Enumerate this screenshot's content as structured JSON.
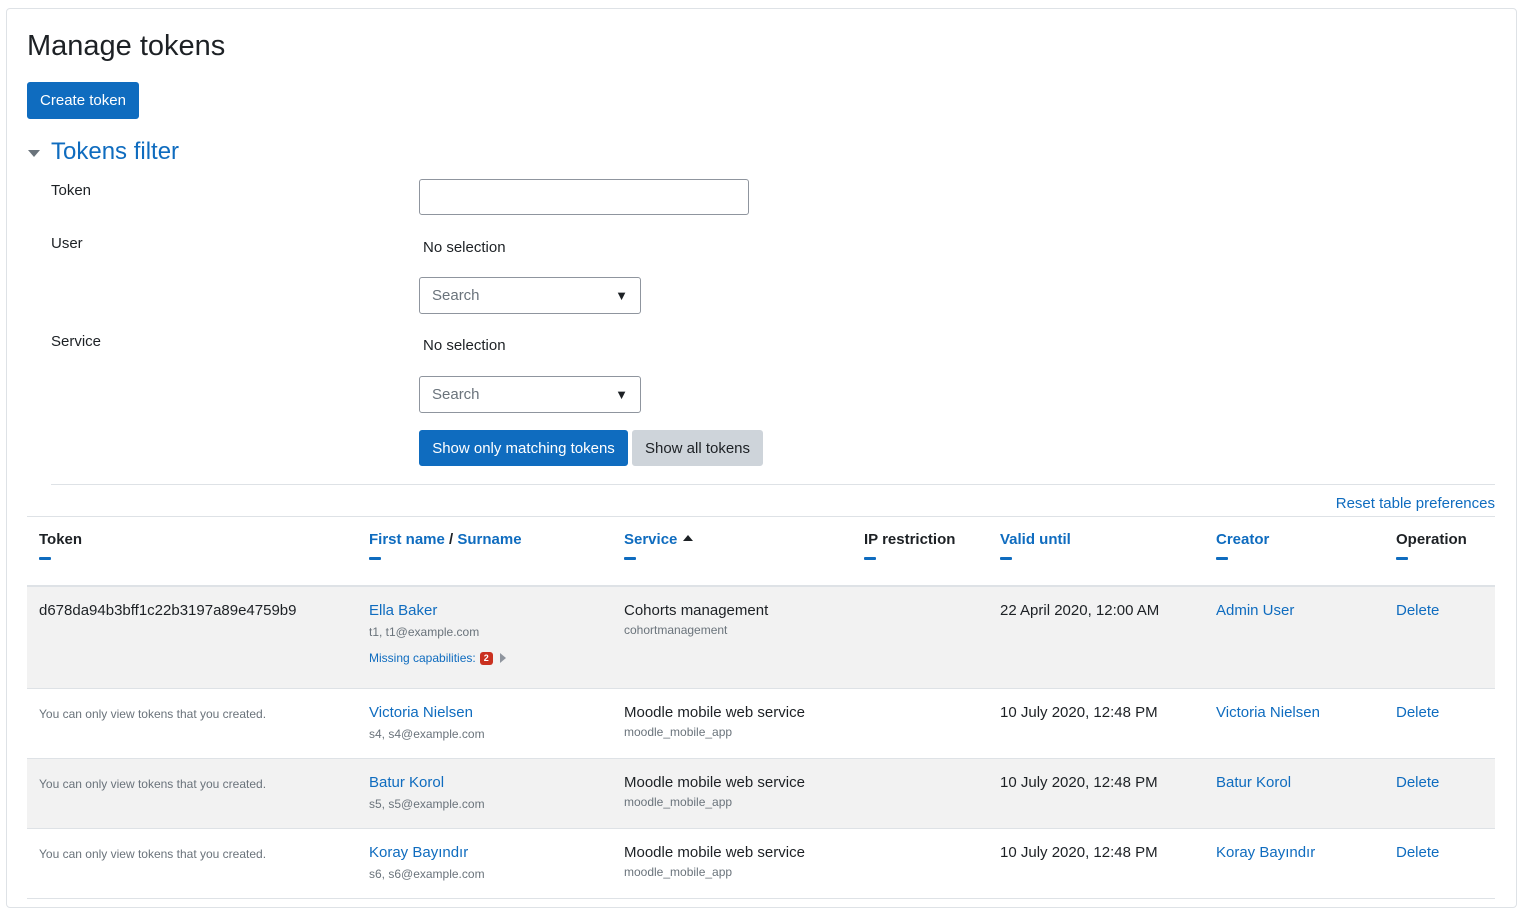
{
  "page": {
    "title": "Manage tokens"
  },
  "create_button": "Create token",
  "filter": {
    "title": "Tokens filter",
    "token_label": "Token",
    "token_value": "",
    "user_label": "User",
    "user_selection": "No selection",
    "user_search_placeholder": "Search",
    "service_label": "Service",
    "service_selection": "No selection",
    "service_search_placeholder": "Search",
    "dropdown_arrow": "▼",
    "show_matching": "Show only matching tokens",
    "show_all": "Show all tokens"
  },
  "reset_link": "Reset table preferences",
  "table": {
    "headers": {
      "token": "Token",
      "first_name": "First name",
      "name_sep": " / ",
      "surname": "Surname",
      "service": "Service",
      "ip_restriction": "IP restriction",
      "valid_until": "Valid until",
      "creator": "Creator",
      "operation": "Operation"
    },
    "rows": [
      {
        "token": "d678da94b3bff1c22b3197a89e4759b9",
        "name": "Ella Baker",
        "user_detail": "t1, t1@example.com",
        "missing_label": "Missing capabilities:",
        "missing_count": "2",
        "service": "Cohorts management",
        "service_short": "cohortmanagement",
        "ip": "",
        "valid_until": "22 April 2020, 12:00 AM",
        "creator": "Admin User",
        "operation": "Delete"
      },
      {
        "token": "You can only view tokens that you created.",
        "name": "Victoria Nielsen",
        "user_detail": "s4, s4@example.com",
        "service": "Moodle mobile web service",
        "service_short": "moodle_mobile_app",
        "ip": "",
        "valid_until": "10 July 2020, 12:48 PM",
        "creator": "Victoria Nielsen",
        "operation": "Delete"
      },
      {
        "token": "You can only view tokens that you created.",
        "name": "Batur Korol",
        "user_detail": "s5, s5@example.com",
        "service": "Moodle mobile web service",
        "service_short": "moodle_mobile_app",
        "ip": "",
        "valid_until": "10 July 2020, 12:48 PM",
        "creator": "Batur Korol",
        "operation": "Delete"
      },
      {
        "token": "You can only view tokens that you created.",
        "name": "Koray Bayındır",
        "user_detail": "s6, s6@example.com",
        "service": "Moodle mobile web service",
        "service_short": "moodle_mobile_app",
        "ip": "",
        "valid_until": "10 July 2020, 12:48 PM",
        "creator": "Koray Bayındır",
        "operation": "Delete"
      }
    ]
  },
  "colors": {
    "primary": "#0f6cbf",
    "secondary": "#ced4da",
    "stripe": "#f2f2f2",
    "badge": "#ca3120"
  }
}
